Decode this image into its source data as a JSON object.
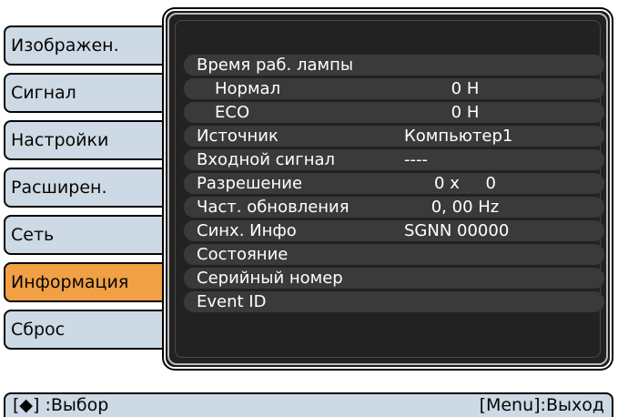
{
  "tabs": [
    {
      "label": "Изображен.",
      "active": false
    },
    {
      "label": "Сигнал",
      "active": false
    },
    {
      "label": "Настройки",
      "active": false
    },
    {
      "label": "Расширен.",
      "active": false
    },
    {
      "label": "Сеть",
      "active": false
    },
    {
      "label": "Информация",
      "active": true
    },
    {
      "label": "Сброс",
      "active": false
    }
  ],
  "info": {
    "lamp_time_label": "Время раб. лампы",
    "normal_label": "Нормал",
    "normal_value": "0 H",
    "eco_label": "ECO",
    "eco_value": "0 H",
    "source_label": "Источник",
    "source_value": "Компьютер1",
    "input_signal_label": "Входной сигнал",
    "input_signal_value": "----",
    "resolution_label": "Разрешение",
    "resolution_value": "0 x     0",
    "refresh_label": "Част. обновления",
    "refresh_value": "0, 00 Hz",
    "sync_label": "Синх. Инфо",
    "sync_value": "SGNN 00000",
    "status_label": "Состояние",
    "serial_label": "Серийный номер",
    "event_label": "Event ID"
  },
  "footer": {
    "select": "[◆] :Выбор",
    "exit": "[Menu]:Выход"
  },
  "colors": {
    "tab_bg": "#cdd9e5",
    "tab_active_bg": "#f1a045",
    "panel_bg": "#222222",
    "row_bg": "#3a3a3a"
  }
}
